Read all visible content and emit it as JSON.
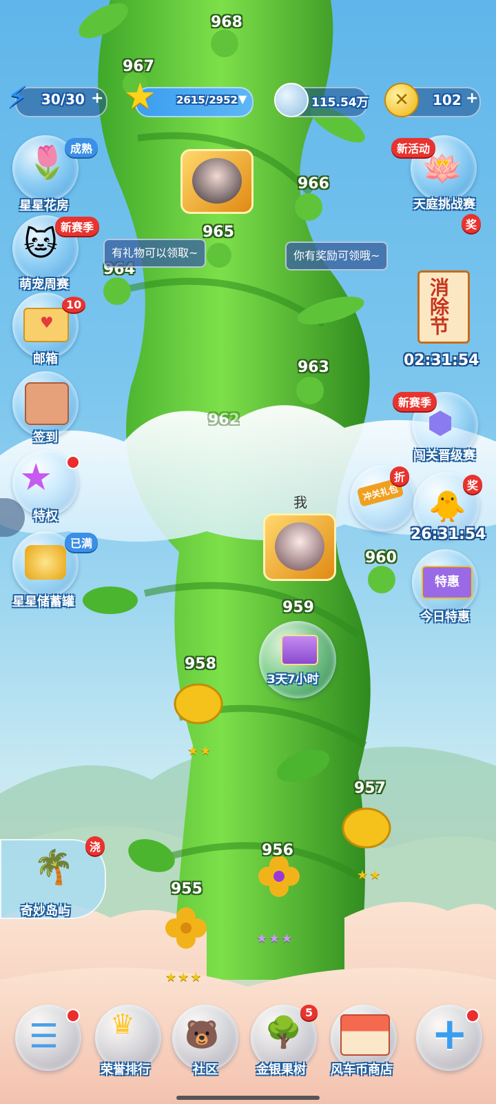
{
  "resources": {
    "energy": "30/30",
    "stars": "2615/2952",
    "coins": "115.54万",
    "gold": "102"
  },
  "levels": [
    "968",
    "967",
    "966",
    "965",
    "964",
    "963",
    "962",
    "960",
    "959",
    "958",
    "957",
    "956",
    "955"
  ],
  "left_menu": [
    {
      "label": "星星花房",
      "badge": "成熟"
    },
    {
      "label": "萌宠周赛",
      "badge": "新赛季"
    },
    {
      "label": "邮箱",
      "badge": "10"
    },
    {
      "label": "签到",
      "badge": ""
    },
    {
      "label": "特权",
      "badge": ""
    },
    {
      "label": "星星储蓄罐",
      "badge": "已满"
    }
  ],
  "right_menu": {
    "tianting": {
      "label": "天庭挑战赛",
      "badge": "新活动"
    },
    "xiaochu": {
      "scroll_text": "消除节",
      "timer": "02:31:54",
      "badge": "奖"
    },
    "chuangguan": {
      "label": "闯关晋级赛",
      "badge": "新赛季"
    },
    "gift": {
      "label": "冲关礼包",
      "badge": "折"
    },
    "chick": {
      "timer": "26:31:54",
      "badge": "奖"
    },
    "deal": {
      "sign": "特惠",
      "label": "今日特惠"
    }
  },
  "tips": {
    "left": "有礼物可以领取~",
    "right": "你有奖励可领哦~"
  },
  "me_label": "我",
  "gift_timer": "3天7小时",
  "island": {
    "label": "奇妙岛屿",
    "badge": "浇"
  },
  "bottom_nav": [
    {
      "label": "",
      "badge": ""
    },
    {
      "label": "荣誉排行",
      "badge": ""
    },
    {
      "label": "社区",
      "badge": ""
    },
    {
      "label": "金银果树",
      "badge": "5"
    },
    {
      "label": "风车币商店",
      "badge": ""
    },
    {
      "label": "",
      "badge": ""
    }
  ]
}
